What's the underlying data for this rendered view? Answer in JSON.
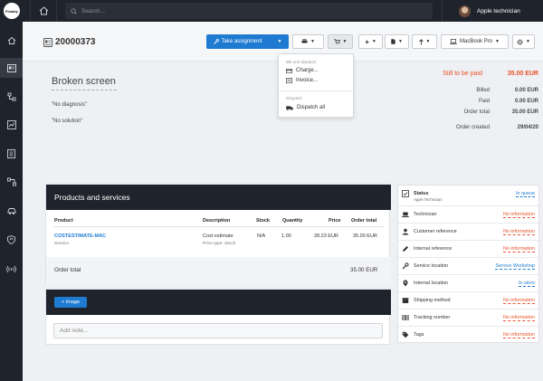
{
  "topbar": {
    "logo_text": "Fixably",
    "search_placeholder": "Search...",
    "user_name": "Apple technician"
  },
  "sidebar": {
    "items": [
      {
        "icon": "home-icon",
        "active": false
      },
      {
        "icon": "id-card-icon",
        "active": true
      },
      {
        "icon": "org-chart-icon",
        "active": false
      },
      {
        "icon": "chart-icon",
        "active": false
      },
      {
        "icon": "book-icon",
        "active": false
      },
      {
        "icon": "flow-icon",
        "active": false
      },
      {
        "icon": "car-icon",
        "active": false
      },
      {
        "icon": "shield-icon",
        "active": false
      },
      {
        "icon": "signal-icon",
        "active": false
      }
    ]
  },
  "header": {
    "ticket_number": "20000373",
    "take_assignment": "Take assignment",
    "device": "MacBook Pro"
  },
  "dropdown": {
    "section1": "Bill and dispatch",
    "charge": "Charge...",
    "invoice": "Invoice...",
    "section2": "Dispatch",
    "dispatch_all": "Dispatch all"
  },
  "ticket": {
    "title": "Broken screen",
    "diagnosis": "\"No diagnosis\"",
    "solution": "\"No solution\""
  },
  "payment": {
    "to_be_paid_label": "Still to be paid",
    "to_be_paid_value": "35.00 EUR",
    "billed_label": "Billed",
    "billed_value": "0.00 EUR",
    "paid_label": "Paid",
    "paid_value": "0.00 EUR",
    "order_total_label": "Order total",
    "order_total_value": "35.00 EUR",
    "order_created_label": "Order created",
    "order_created_value": "29/04/20"
  },
  "products": {
    "title": "Products and services",
    "columns": [
      "Product",
      "Description",
      "Stock",
      "Quantity",
      "Price",
      "Order total"
    ],
    "row": {
      "product": "COSTESTIMATE-MAC",
      "product_sub": "Service",
      "description": "Cost estimate",
      "description_sub": "Price type: Stock",
      "stock": "N/A",
      "quantity": "1.00",
      "price": "28.23 EUR",
      "order_total": "35.00 EUR"
    },
    "total_label": "Order total",
    "total_value": "35.00 EUR"
  },
  "note": {
    "image_button": "+ Image",
    "placeholder": "Add note..."
  },
  "info": [
    {
      "label": "Status",
      "sub": "Apple Technician",
      "value": "In queue",
      "color": "blue",
      "icon": "checkbox-icon"
    },
    {
      "label": "Technician",
      "sub": "",
      "value": "No information",
      "color": "red",
      "icon": "laptop-icon"
    },
    {
      "label": "Customer reference",
      "sub": "",
      "value": "No information",
      "color": "red",
      "icon": "user-icon"
    },
    {
      "label": "Internal reference",
      "sub": "",
      "value": "No information",
      "color": "red",
      "icon": "pencil-icon"
    },
    {
      "label": "Service location",
      "sub": "",
      "value": "Service Workshop",
      "color": "blue",
      "icon": "wrench-icon"
    },
    {
      "label": "Internal location",
      "sub": "",
      "value": "In store",
      "color": "blue",
      "icon": "pin-icon"
    },
    {
      "label": "Shipping method",
      "sub": "",
      "value": "No information",
      "color": "red",
      "icon": "box-icon"
    },
    {
      "label": "Tracking number",
      "sub": "",
      "value": "No information",
      "color": "red",
      "icon": "barcode-icon"
    },
    {
      "label": "Tags",
      "sub": "",
      "value": "No information",
      "color": "red",
      "icon": "tag-icon"
    }
  ],
  "colors": {
    "accent": "#1f7bd1",
    "alert": "#e8532b",
    "dark": "#1f232b"
  }
}
